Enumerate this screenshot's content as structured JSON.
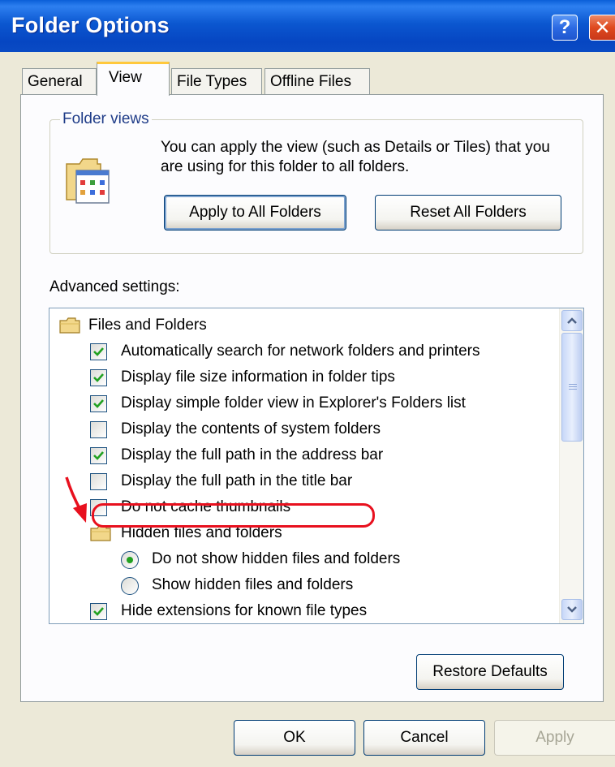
{
  "window": {
    "title": "Folder Options"
  },
  "titlebar": {
    "help_label": "?",
    "close_label": "✕"
  },
  "tabs": [
    {
      "label": "General",
      "active": false
    },
    {
      "label": "View",
      "active": true
    },
    {
      "label": "File Types",
      "active": false
    },
    {
      "label": "Offline Files",
      "active": false
    }
  ],
  "folder_views": {
    "legend": "Folder views",
    "description": "You can apply the view (such as Details or Tiles) that you are using for this folder to all folders.",
    "apply_button": "Apply to All Folders",
    "reset_button": "Reset All Folders"
  },
  "advanced": {
    "label": "Advanced settings:",
    "items": [
      {
        "type": "folder",
        "label": "Files and Folders"
      },
      {
        "type": "checkbox",
        "label": "Automatically search for network folders and printers",
        "checked": true
      },
      {
        "type": "checkbox",
        "label": "Display file size information in folder tips",
        "checked": true
      },
      {
        "type": "checkbox",
        "label": "Display simple folder view in Explorer's Folders list",
        "checked": true
      },
      {
        "type": "checkbox",
        "label": "Display the contents of system folders",
        "checked": false
      },
      {
        "type": "checkbox",
        "label": "Display the full path in the address bar",
        "checked": true
      },
      {
        "type": "checkbox",
        "label": "Display the full path in the title bar",
        "checked": false
      },
      {
        "type": "checkbox",
        "label": "Do not cache thumbnails",
        "checked": false
      },
      {
        "type": "folder",
        "label": "Hidden files and folders"
      },
      {
        "type": "radio",
        "label": "Do not show hidden files and folders",
        "selected": true
      },
      {
        "type": "radio",
        "label": "Show hidden files and folders",
        "selected": false
      },
      {
        "type": "checkbox",
        "label": "Hide extensions for known file types",
        "checked": true,
        "highlighted": true
      }
    ]
  },
  "restore_button": "Restore Defaults",
  "footer": {
    "ok": "OK",
    "cancel": "Cancel",
    "apply": "Apply"
  },
  "colors": {
    "titlebar": "#0B57D0",
    "dialog_bg": "#ECE9D8",
    "panel_bg": "#FCFCFE",
    "active_tab_accent": "#FFC83C",
    "check_mark": "#21A121",
    "annotation_red": "#E8101E"
  }
}
